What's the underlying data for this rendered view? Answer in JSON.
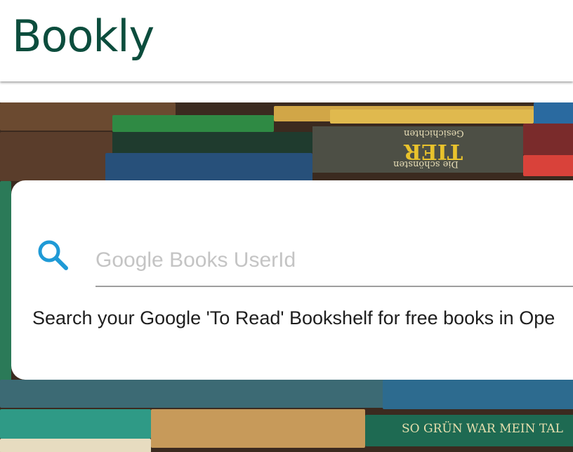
{
  "header": {
    "brand": "Bookly"
  },
  "search": {
    "placeholder": "Google Books UserId",
    "value": "",
    "icon": "search-icon",
    "hint": "Search your Google 'To Read' Bookshelf for free books in Ope"
  },
  "hero": {
    "spines": [
      "Gesichichten",
      "TIER",
      "Die schönsten",
      "SO GRÜN WAR MEIN TAL"
    ]
  },
  "colors": {
    "brand": "#0c4d3d",
    "search_icon": "#1f9ad6",
    "input_underline": "#9e9e9e"
  }
}
